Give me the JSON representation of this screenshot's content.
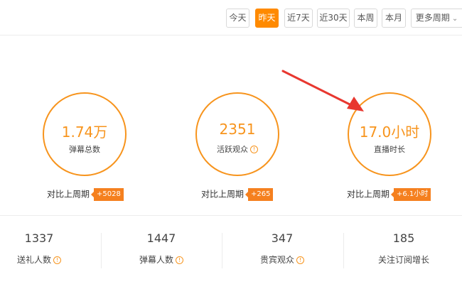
{
  "toolbar": {
    "buttons": [
      "今天",
      "昨天",
      "近7天",
      "近30天",
      "本周",
      "本月",
      "更多周期"
    ],
    "active_index": 1
  },
  "stats": [
    {
      "value": "1.74万",
      "label": "弹幕总数",
      "compare_label": "对比上周期",
      "delta": "+5028"
    },
    {
      "value": "2351",
      "label": "活跃观众",
      "compare_label": "对比上周期",
      "delta": "+265"
    },
    {
      "value": "17.0小时",
      "label": "直播时长",
      "compare_label": "对比上周期",
      "delta": "+6.1小时"
    }
  ],
  "metrics": [
    {
      "value": "1337",
      "label": "送礼人数"
    },
    {
      "value": "1447",
      "label": "弹幕人数"
    },
    {
      "value": "347",
      "label": "贵宾观众"
    },
    {
      "value": "185",
      "label": "关注订阅增长"
    }
  ],
  "colors": {
    "accent": "#f7941d",
    "arrow": "#e8372f"
  },
  "icons": {
    "info": "!",
    "chevron": "⌄"
  }
}
